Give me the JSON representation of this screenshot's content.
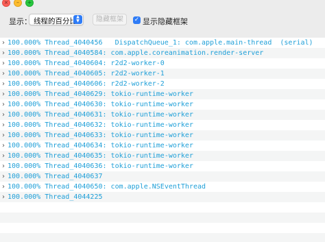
{
  "titlebar": {
    "close_symbol": "×",
    "minimize_symbol": "–",
    "zoom_symbol": "+"
  },
  "toolbar": {
    "show_label": "显示：",
    "display_mode": {
      "value": "线程的百分比"
    },
    "hide_frames_button": "隐藏框架",
    "show_hidden_checkbox": {
      "label": "显示隐藏框架",
      "checked": true
    }
  },
  "colors": {
    "row_text": "#1e9fd8",
    "accent": "#2f7cf6",
    "alt_row": "#f4f5f5"
  },
  "threads": [
    {
      "percent": "100.000%",
      "name": "Thread_4040456",
      "queue": "DispatchQueue_1: com.apple.main-thread  (serial)"
    },
    {
      "percent": "100.000%",
      "name": "Thread_4040584:",
      "queue": "com.apple.coreanimation.render-server"
    },
    {
      "percent": "100.000%",
      "name": "Thread_4040604:",
      "queue": "r2d2-worker-0"
    },
    {
      "percent": "100.000%",
      "name": "Thread_4040605:",
      "queue": "r2d2-worker-1"
    },
    {
      "percent": "100.000%",
      "name": "Thread_4040606:",
      "queue": "r2d2-worker-2"
    },
    {
      "percent": "100.000%",
      "name": "Thread_4040629:",
      "queue": "tokio-runtime-worker"
    },
    {
      "percent": "100.000%",
      "name": "Thread_4040630:",
      "queue": "tokio-runtime-worker"
    },
    {
      "percent": "100.000%",
      "name": "Thread_4040631:",
      "queue": "tokio-runtime-worker"
    },
    {
      "percent": "100.000%",
      "name": "Thread_4040632:",
      "queue": "tokio-runtime-worker"
    },
    {
      "percent": "100.000%",
      "name": "Thread_4040633:",
      "queue": "tokio-runtime-worker"
    },
    {
      "percent": "100.000%",
      "name": "Thread_4040634:",
      "queue": "tokio-runtime-worker"
    },
    {
      "percent": "100.000%",
      "name": "Thread_4040635:",
      "queue": "tokio-runtime-worker"
    },
    {
      "percent": "100.000%",
      "name": "Thread_4040636:",
      "queue": "tokio-runtime-worker"
    },
    {
      "percent": "100.000%",
      "name": "Thread_4040637",
      "queue": ""
    },
    {
      "percent": "100.000%",
      "name": "Thread_4040650:",
      "queue": "com.apple.NSEventThread"
    },
    {
      "percent": "100.000%",
      "name": "Thread_4044225",
      "queue": ""
    }
  ]
}
